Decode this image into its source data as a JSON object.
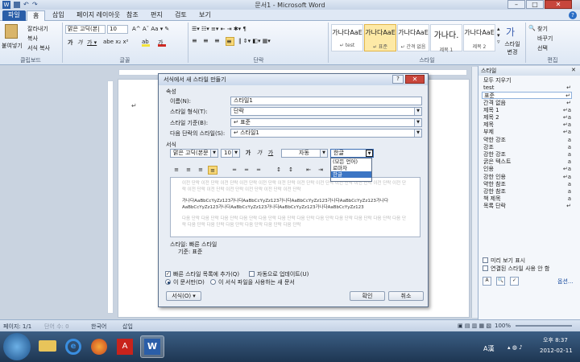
{
  "window": {
    "title": "문서1 - Microsoft Word",
    "min": "–",
    "max": "□",
    "close": "✕"
  },
  "ribbon_tabs": [
    "파일",
    "홈",
    "삽입",
    "페이지 레이아웃",
    "참조",
    "편지",
    "검토",
    "보기"
  ],
  "ribbon": {
    "paste": "붙여넣기",
    "cut": "잘라내기",
    "copy": "복사",
    "format_painter": "서식 복사",
    "clipboard_label": "클립보드",
    "font_label": "글꼴",
    "paragraph_label": "단락",
    "styles_label": "스타일",
    "editing_label": "편집",
    "font_name": "맑은 고딕(본|",
    "font_size": "10",
    "find": "찾기",
    "replace": "바꾸기",
    "select": "선택",
    "change_styles": "스타일 변경",
    "gallery": [
      {
        "preview": "가나다AaE",
        "name": "↵ test"
      },
      {
        "preview": "가나다AaE",
        "name": "↵ 표준",
        "selected": true
      },
      {
        "preview": "가나다AaE",
        "name": "↵ 간격 없음"
      },
      {
        "preview": "가나다.",
        "name": "제목 1"
      },
      {
        "preview": "가나다AaE",
        "name": "제목 2"
      }
    ]
  },
  "styles_pane": {
    "title": "스타일",
    "items": [
      {
        "name": "모두 지우기",
        "mark": ""
      },
      {
        "name": "test",
        "mark": "↵"
      },
      {
        "name": "표준",
        "mark": "↵",
        "selected": true
      },
      {
        "name": "간격 없음",
        "mark": "↵"
      },
      {
        "name": "제목 1",
        "mark": "↵a"
      },
      {
        "name": "제목 2",
        "mark": "↵a"
      },
      {
        "name": "제목",
        "mark": "↵a"
      },
      {
        "name": "부제",
        "mark": "↵a"
      },
      {
        "name": "약한 강조",
        "mark": "a"
      },
      {
        "name": "강조",
        "mark": "a"
      },
      {
        "name": "강한 강조",
        "mark": "a"
      },
      {
        "name": "굵은 텍스트",
        "mark": "a"
      },
      {
        "name": "인용",
        "mark": "↵a"
      },
      {
        "name": "강한 인용",
        "mark": "↵a"
      },
      {
        "name": "약한 참조",
        "mark": "a"
      },
      {
        "name": "강한 참조",
        "mark": "a"
      },
      {
        "name": "책 제목",
        "mark": "a"
      },
      {
        "name": "목록 단락",
        "mark": "↵"
      }
    ],
    "show_preview": "미리 보기 표시",
    "disable_linked": "연결된 스타일 사용 안 함",
    "options": "옵션..."
  },
  "status": {
    "page": "페이지: 1/1",
    "words": "단어 수: 0",
    "language": "한국어",
    "mode": "삽입",
    "zoom": "100%"
  },
  "taskbar": {
    "clock_time": "오후 8:37",
    "clock_date": "2012-02-11",
    "ime": "A漢"
  },
  "dialog": {
    "title": "서식에서 새 스타일 만들기",
    "help": "?",
    "close": "✕",
    "section_props": "속성",
    "name_label": "이름(N):",
    "name_value": "스타일1",
    "type_label": "스타일 형식(T):",
    "type_value": "단락",
    "based_label": "스타일 기준(B):",
    "based_value": "↵ 표준",
    "next_label": "다음 단락의 스타일(S):",
    "next_value": "↵ 스타일1",
    "section_format": "서식",
    "font_value": "맑은 고딕(본문",
    "size_value": "10",
    "bold": "가",
    "italic": "가",
    "underline": "가",
    "color_value": "자동",
    "script_value": "한글",
    "script_options": [
      "(모든 언어)",
      "로마자",
      "한글"
    ],
    "preview_before": "이전 단락 이전 단락 이전 단락 이전 단락 이전 단락 이전 단락 이전 단락 이전 단락 이전 단락 이전 단락 이전 단락 이전 단락 이전 단락 이전 단락 이전 단락 이전 단락 이전 단락 이전 단락",
    "preview_sample_1": "가나다AaBbCcYyZz123가나다AaBbCcYyZz123가나다AaBbCcYyZz123가나다AaBbCcYyZz123가나다",
    "preview_sample_2": "AaBbCcYyZz123가나다AaBbCcYyZz123가나다AaBbCcYyZz123가나다AaBbCcYyZz123",
    "preview_after": "다음 단락 다음 단락 다음 단락 다음 단락 다음 단락 다음 단락 다음 단락 다음 단락 다음 단락 다음 단락 다음 단락 다음 단락 다음 단락 다음 단락 다음 단락 다음 단락 다음 단락 다음 단락",
    "desc_line1": "스타일: 빠른 스타일",
    "desc_line2": "기준: 표준",
    "quick_list": "빠른 스타일 목록에 추가(Q)",
    "auto_update": "자동으로 업데이트(U)",
    "only_doc": "이 문서만(D)",
    "new_docs": "이 서식 파일을 사용하는 새 문서",
    "format_btn": "서식(O) ▾",
    "ok": "확인",
    "cancel": "취소"
  },
  "colors": {
    "file_tab": "#2a5ea8",
    "accent": "#3b75c4",
    "close": "#c7463c"
  }
}
